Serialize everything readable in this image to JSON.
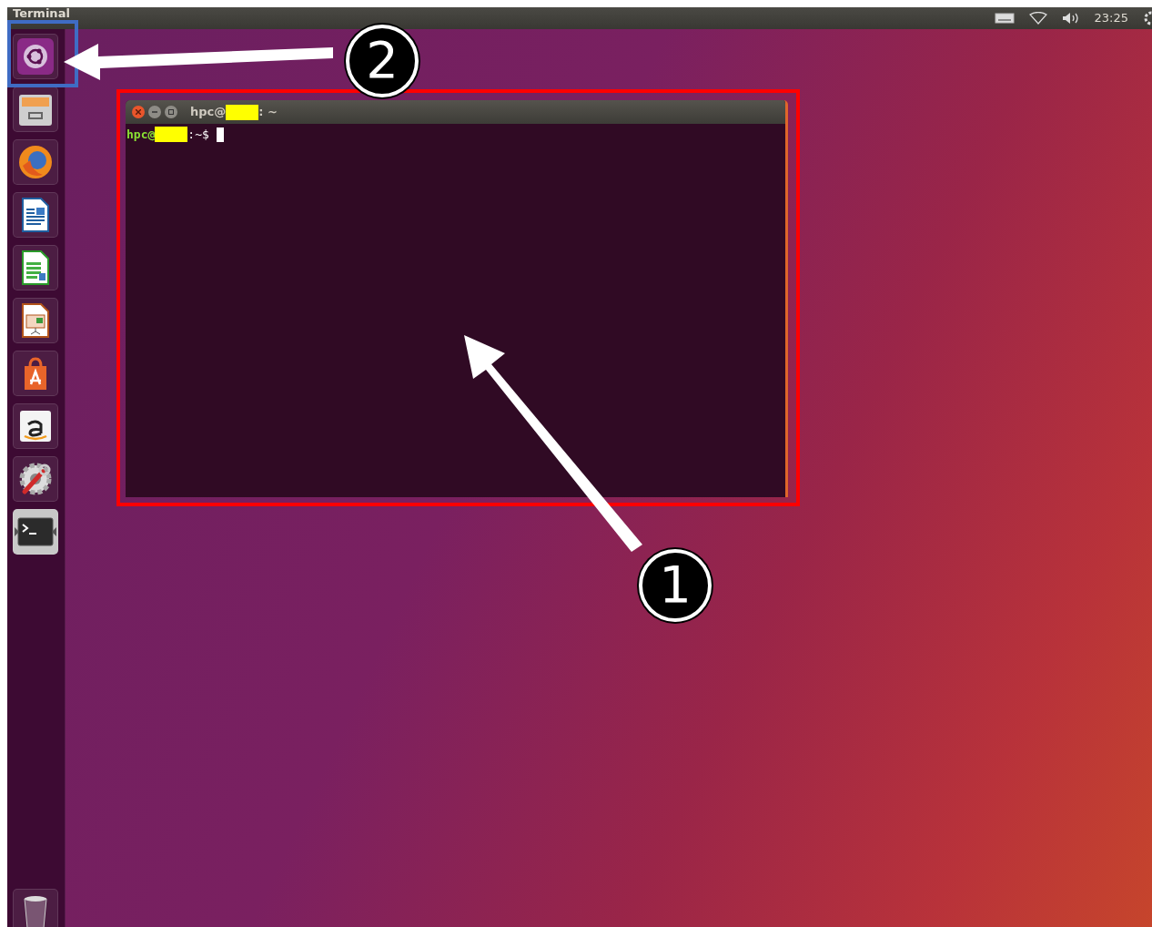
{
  "top_bar": {
    "title": "Terminal",
    "clock": "23:25"
  },
  "launcher": {
    "items": [
      {
        "kind": "dash",
        "focused": false
      },
      {
        "kind": "files",
        "focused": false
      },
      {
        "kind": "firefox",
        "focused": false
      },
      {
        "kind": "writer",
        "focused": false
      },
      {
        "kind": "calc",
        "focused": false
      },
      {
        "kind": "impress",
        "focused": false
      },
      {
        "kind": "software",
        "focused": false
      },
      {
        "kind": "amazon",
        "focused": false
      },
      {
        "kind": "settings",
        "focused": false
      },
      {
        "kind": "terminal",
        "focused": true
      }
    ],
    "trash": {
      "kind": "trash",
      "focused": false
    }
  },
  "terminal": {
    "title_prefix": "hpc@",
    "title_suffix": ": ~",
    "prompt_user": "hpc@",
    "prompt_rest": ":~$"
  },
  "annotations": [
    {
      "number": "2",
      "color": "#3f6cc4"
    },
    {
      "number": "1",
      "color": "#ff0000"
    }
  ]
}
